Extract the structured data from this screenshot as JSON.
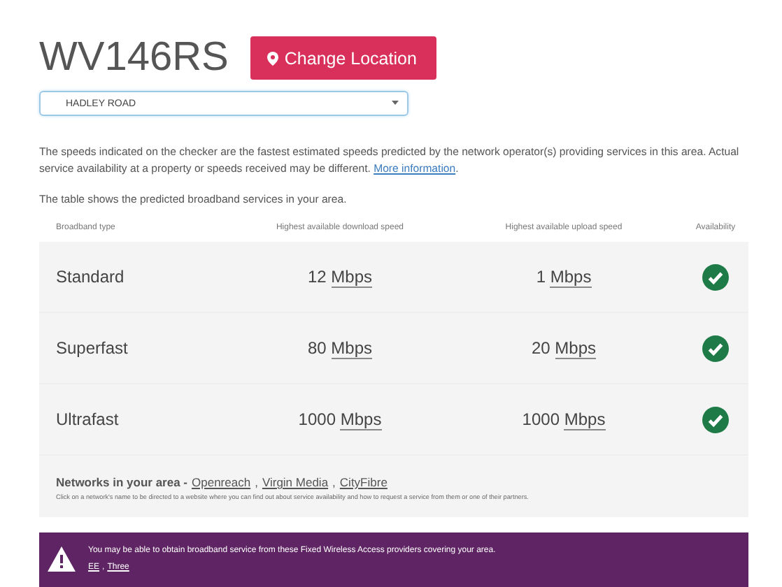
{
  "postcode": "WV146RS",
  "change_button": "Change Location",
  "address_select": {
    "value": "HADLEY ROAD"
  },
  "disclaimer": {
    "text": "The speeds indicated on the checker are the fastest estimated speeds predicted by the network operator(s) providing services in this area. Actual service availability at a property or speeds received may be different.",
    "link": "More information",
    "end": "."
  },
  "table_intro": "The table shows the predicted broadband services in your area.",
  "table": {
    "columns": [
      "Broadband type",
      "Highest available download speed",
      "Highest available upload speed",
      "Availability"
    ],
    "rows": [
      {
        "type": "Standard",
        "download": "12",
        "download_unit": "Mbps",
        "upload": "1",
        "upload_unit": "Mbps",
        "available": true
      },
      {
        "type": "Superfast",
        "download": "80",
        "download_unit": "Mbps",
        "upload": "20",
        "upload_unit": "Mbps",
        "available": true
      },
      {
        "type": "Ultrafast",
        "download": "1000",
        "download_unit": "Mbps",
        "upload": "1000",
        "upload_unit": "Mbps",
        "available": true
      }
    ]
  },
  "networks": {
    "label": "Networks in your area -",
    "links": [
      "Openreach",
      "Virgin Media",
      "CityFibre"
    ],
    "separator": ",",
    "note": "Click on a network's name to be directed to a website where you can find out about service availability and how to request a service from them or one of their partners."
  },
  "fixed_wireless_banner": {
    "text": "You may be able to obtain broadband service from these Fixed Wireless Access providers covering your area.",
    "links": [
      "EE",
      "Three"
    ],
    "separator": ","
  }
}
